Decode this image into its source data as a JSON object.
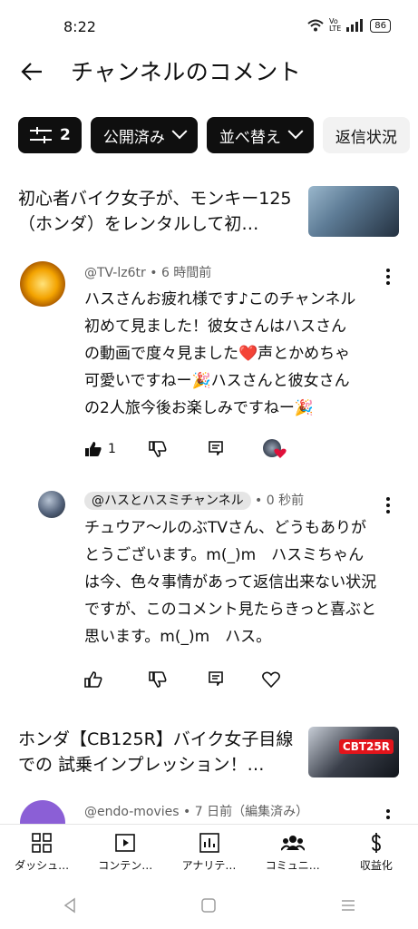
{
  "status_bar": {
    "time": "8:22",
    "battery": "86"
  },
  "header": {
    "title": "チャンネルのコメント"
  },
  "filters": {
    "filter_count": "2",
    "chips": [
      {
        "label": "公開済み"
      },
      {
        "label": "並べ替え"
      },
      {
        "label": "返信状況"
      }
    ]
  },
  "videos": [
    {
      "title": "初心者バイク女子が、モンキー125（ホンダ）をレンタルして初…"
    },
    {
      "title": "ホンダ【CB125R】バイク女子目線での 試乗インプレッション！…"
    }
  ],
  "comments": [
    {
      "author": "@TV-lz6tr",
      "time": "6 時間前",
      "text": "ハスさんお疲れ様です♪このチャンネル初めて見ました！彼女さんはハスさんの動画で度々見ました❤️声とかめちゃ可愛いですねー🎉ハスさんと彼女さんの2人旅今後お楽しみですねー🎉",
      "likes": "1",
      "reply": {
        "author": "@ハスとハスミチャンネル",
        "time": "0 秒前",
        "text": "チュウア〜ルのぶTVさん、どうもありがとうございます。m(_)m　ハスミちゃんは今、色々事情があって返信出来ない状況ですが、このコメント見たらきっと喜ぶと思います。m(_)m　ハス。"
      }
    },
    {
      "author": "@endo-movies",
      "time": "7 日前（編集済み）"
    }
  ],
  "nav": [
    {
      "label": "ダッシュ…"
    },
    {
      "label": "コンテン…"
    },
    {
      "label": "アナリテ…"
    },
    {
      "label": "コミュニ…"
    },
    {
      "label": "収益化"
    }
  ]
}
